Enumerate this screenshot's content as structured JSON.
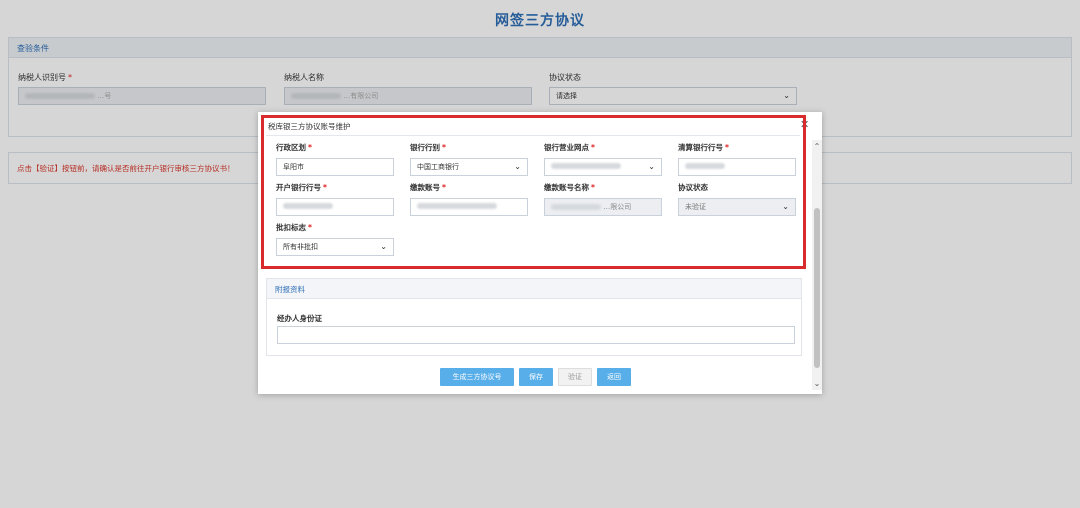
{
  "page": {
    "title": "网签三方协议",
    "query_panel": {
      "title": "查验条件",
      "taxpayer_id_label": "纳税人识别号",
      "taxpayer_id_value": "…号",
      "taxpayer_name_label": "纳税人名称",
      "taxpayer_name_value": "…有限公司",
      "status_label": "协议状态",
      "status_value": "请选择"
    },
    "notice": "点击【验证】按钮前，请确认是否前往开户银行审核三方协议书！"
  },
  "modal": {
    "section_title": "税库银三方协议账号维护",
    "fields": {
      "admin_region": {
        "label": "行政区划",
        "value": "阜阳市"
      },
      "bank_category": {
        "label": "银行行别",
        "value": "中国工商银行"
      },
      "bank_branch": {
        "label": "银行营业网点",
        "value": ""
      },
      "clearing_bank_no": {
        "label": "清算银行行号",
        "value": ""
      },
      "opening_bank_no": {
        "label": "开户银行行号",
        "value": ""
      },
      "payment_account": {
        "label": "缴款账号",
        "value": ""
      },
      "account_name": {
        "label": "缴款账号名称",
        "value": "…限公司"
      },
      "agreement_status": {
        "label": "协议状态",
        "value": "未验证"
      },
      "batch_flag": {
        "label": "批扣标志",
        "value": "所有非批扣"
      }
    },
    "attachments": {
      "title": "附报资料",
      "id_label": "经办人身份证"
    },
    "buttons": {
      "generate": "生成三方协议号",
      "save": "保存",
      "verify": "验证",
      "back": "返回"
    },
    "close_icon": "close-icon"
  }
}
